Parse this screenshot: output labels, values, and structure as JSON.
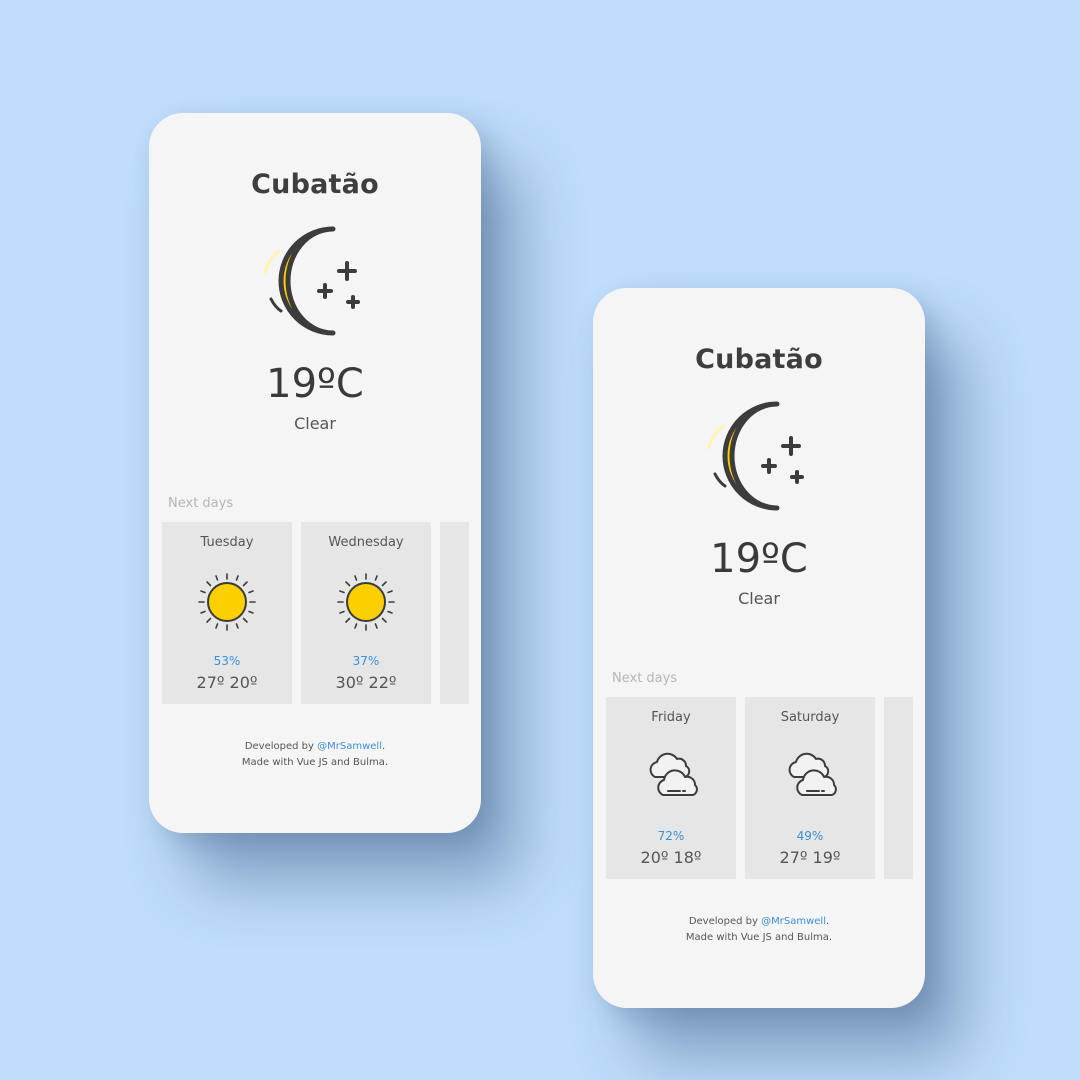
{
  "colors": {
    "background": "#bfdcfb",
    "card": "#f5f5f5",
    "day_card": "#e6e6e6",
    "accent": "#3b8fd6",
    "icon_yellow": "#fccf00",
    "icon_outline": "#3c3c3c"
  },
  "screens": [
    {
      "city": "Cubatão",
      "main_icon": "moon-stars-icon",
      "temperature": "19ºC",
      "condition": "Clear",
      "next_days_label": "Next days",
      "days": [
        {
          "day": "Tuesday",
          "icon": "sun-icon",
          "humidity": "53%",
          "max": "27º",
          "min": "20º"
        },
        {
          "day": "Wednesday",
          "icon": "sun-icon",
          "humidity": "37%",
          "max": "30º",
          "min": "22º"
        }
      ],
      "footer": {
        "developed_by": "Developed by",
        "author": "@MrSamwell",
        "period": ".",
        "made_with": "Made with Vue JS and Bulma."
      }
    },
    {
      "city": "Cubatão",
      "main_icon": "moon-stars-icon",
      "temperature": "19ºC",
      "condition": "Clear",
      "next_days_label": "Next days",
      "days": [
        {
          "day": "Friday",
          "icon": "cloud-icon",
          "humidity": "72%",
          "max": "20º",
          "min": "18º"
        },
        {
          "day": "Saturday",
          "icon": "cloud-icon",
          "humidity": "49%",
          "max": "27º",
          "min": "19º"
        }
      ],
      "footer": {
        "developed_by": "Developed by",
        "author": "@MrSamwell",
        "period": ".",
        "made_with": "Made with Vue JS and Bulma."
      }
    }
  ]
}
